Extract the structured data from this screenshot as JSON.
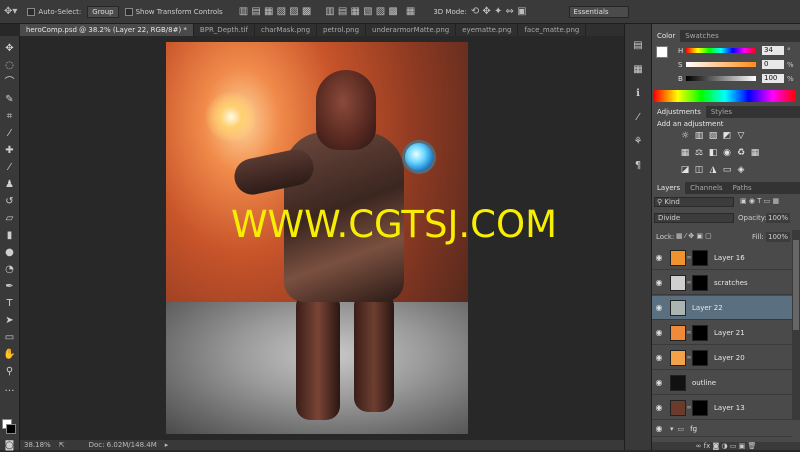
{
  "options_bar": {
    "auto_select_label": "Auto-Select:",
    "auto_select_value": "Group",
    "transform_controls_label": "Show Transform Controls",
    "mode_3d_label": "3D Mode:",
    "workspace": "Essentials"
  },
  "tabs": [
    {
      "label": "heroComp.psd @ 38.2% (Layer 22, RGB/8#) *",
      "active": true
    },
    {
      "label": "BPR_Depth.tif",
      "active": false
    },
    {
      "label": "charMask.png",
      "active": false
    },
    {
      "label": "petrol.png",
      "active": false
    },
    {
      "label": "underarmorMatte.png",
      "active": false
    },
    {
      "label": "eyematte.png",
      "active": false
    },
    {
      "label": "face_matte.png",
      "active": false
    }
  ],
  "canvas": {
    "watermark": "WWW.CGTSJ.COM"
  },
  "status_bar": {
    "zoom": "38.18%",
    "doc": "Doc: 6.02M/148.4M"
  },
  "color_panel": {
    "tabs": [
      "Color",
      "Swatches"
    ],
    "h_label": "H",
    "h_value": "34",
    "h_unit": "°",
    "s_label": "S",
    "s_value": "0",
    "s_unit": "%",
    "b_label": "B",
    "b_value": "100",
    "b_unit": "%"
  },
  "adjustments_panel": {
    "tabs": [
      "Adjustments",
      "Styles"
    ],
    "heading": "Add an adjustment"
  },
  "layers_panel": {
    "tabs": [
      "Layers",
      "Channels",
      "Paths"
    ],
    "filter_kind": "Kind",
    "blend_mode": "Divide",
    "opacity_label": "Opacity:",
    "opacity_value": "100%",
    "lock_label": "Lock:",
    "fill_label": "Fill:",
    "fill_value": "100%",
    "layers": [
      {
        "name": "Layer 16",
        "thumb": "#f0922e",
        "has_mask": true,
        "selected": false
      },
      {
        "name": "scratches",
        "thumb": "#cfcfcf",
        "has_mask": true,
        "selected": false
      },
      {
        "name": "Layer 22",
        "thumb": "#aab4b0",
        "has_mask": false,
        "selected": true
      },
      {
        "name": "Layer 21",
        "thumb": "#ee8a3a",
        "has_mask": true,
        "selected": false
      },
      {
        "name": "Layer 20",
        "thumb": "#f3a24a",
        "has_mask": true,
        "selected": false
      },
      {
        "name": "outline",
        "thumb": "#111111",
        "has_mask": false,
        "selected": false
      },
      {
        "name": "Layer 13",
        "thumb": "#6a3a2a",
        "has_mask": true,
        "selected": false
      }
    ],
    "group_name": "fg"
  }
}
